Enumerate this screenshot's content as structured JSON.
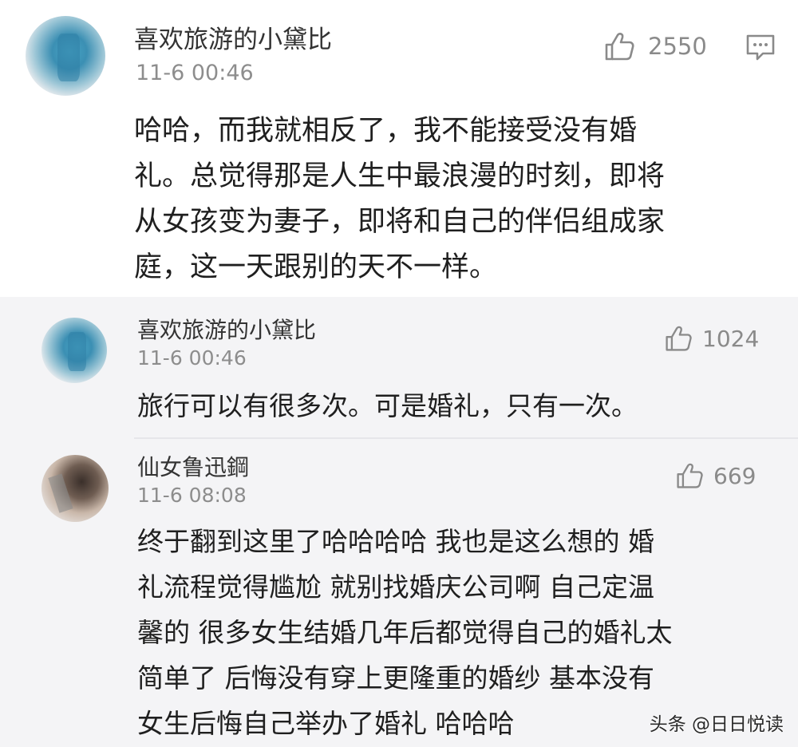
{
  "comments": [
    {
      "user": "喜欢旅游的小黛比",
      "time": "11-6 00:46",
      "likes": "2550",
      "lines": [
        "哈哈，而我就相反了，我不能接受没有婚",
        "礼。总觉得那是人生中最浪漫的时刻，即将",
        "从女孩变为妻子，即将和自己的伴侣组成家",
        "庭，这一天跟别的天不一样。"
      ]
    }
  ],
  "replies": [
    {
      "user": "喜欢旅游的小黛比",
      "time": "11-6 00:46",
      "likes": "1024",
      "lines": [
        "旅行可以有很多次。可是婚礼，只有一次。"
      ]
    },
    {
      "user": "仙女鲁迅鋼",
      "time": "11-6 08:08",
      "likes": "669",
      "lines": [
        "终于翻到这里了哈哈哈哈 我也是这么想的 婚",
        "礼流程觉得尴尬 就别找婚庆公司啊 自己定温",
        "馨的 很多女生结婚几年后都觉得自己的婚礼太",
        "简单了 后悔没有穿上更隆重的婚纱 基本没有",
        "女生后悔自己举办了婚礼 哈哈哈"
      ]
    }
  ],
  "icons": {
    "like": "thumbs-up-icon",
    "reply": "comment-icon"
  },
  "watermark": "头条 @日日悦读"
}
